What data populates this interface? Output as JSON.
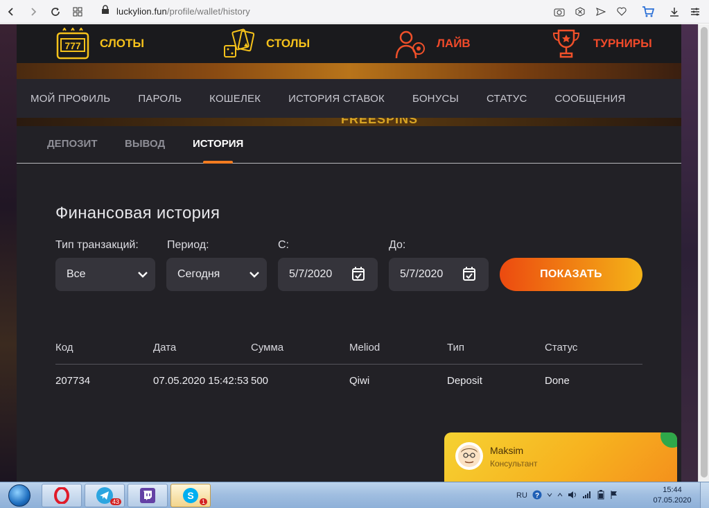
{
  "browser": {
    "url_domain": "luckylion.fun",
    "url_path": "/profile/wallet/history"
  },
  "categories": [
    {
      "label": "СЛОТЫ",
      "icon": "slot-machine-icon"
    },
    {
      "label": "СТОЛЫ",
      "icon": "cards-dice-icon"
    },
    {
      "label": "ЛАЙВ",
      "icon": "live-dealer-icon"
    },
    {
      "label": "ТУРНИРЫ",
      "icon": "trophy-icon"
    }
  ],
  "profile_nav": [
    "МОЙ ПРОФИЛЬ",
    "ПАРОЛЬ",
    "КОШЕЛЕК",
    "ИСТОРИЯ СТАВОК",
    "БОНУСЫ",
    "СТАТУС",
    "СООБЩЕНИЯ"
  ],
  "banner_text": "FREESPINS",
  "sub_tabs": {
    "deposit": "ДЕПОЗИТ",
    "withdraw": "ВЫВОД",
    "history": "ИСТОРИЯ"
  },
  "section_title": "Финансовая история",
  "filters": {
    "type_label": "Тип транзакций:",
    "type_value": "Все",
    "period_label": "Период:",
    "period_value": "Сегодня",
    "from_label": "С:",
    "from_value": "5/7/2020",
    "to_label": "До:",
    "to_value": "5/7/2020",
    "show_button": "ПОКАЗАТЬ"
  },
  "table": {
    "headers": [
      "Код",
      "Дата",
      "Сумма",
      "Meliod",
      "Тип",
      "Статус"
    ],
    "rows": [
      [
        "207734",
        "07.05.2020 15:42:53",
        "500",
        "Qiwi",
        "Deposit",
        "Done"
      ]
    ]
  },
  "chat": {
    "name": "Maksim",
    "role": "Консультант"
  },
  "taskbar": {
    "telegram_badge": "43",
    "skype_badge": "1",
    "lang": "RU",
    "time": "15:44",
    "date": "07.05.2020"
  },
  "colors": {
    "accent_orange": "#f47c20",
    "gold": "#f6c21b",
    "red": "#f04a2a"
  }
}
